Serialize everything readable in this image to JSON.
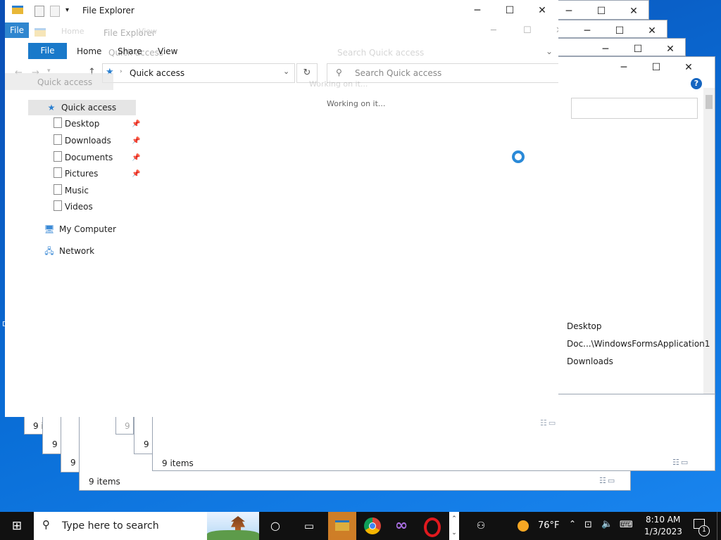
{
  "app": {
    "title": "File Explorer"
  },
  "ribbon": {
    "file": "File",
    "home": "Home",
    "share": "Share",
    "view": "View"
  },
  "address": {
    "location": "Quick access"
  },
  "search": {
    "placeholder": "Search Quick access"
  },
  "status": {
    "working": "Working on it...",
    "items": "9 items"
  },
  "sidebar": {
    "quick_access": "Quick access",
    "items": [
      {
        "label": "Desktop",
        "pinned": true
      },
      {
        "label": "Downloads",
        "pinned": true
      },
      {
        "label": "Documents",
        "pinned": true
      },
      {
        "label": "Pictures",
        "pinned": true
      },
      {
        "label": "Music",
        "pinned": false
      },
      {
        "label": "Videos",
        "pinned": false
      }
    ],
    "my_computer": "My Computer",
    "network": "Network"
  },
  "recent_paths": [
    "Desktop",
    "Doc...\\WindowsFormsApplication1",
    "Downloads"
  ],
  "partial_counts": [
    "9 i",
    "9 i",
    "9 i",
    "9 i"
  ],
  "taskbar": {
    "search_placeholder": "Type here to search",
    "temperature": "76°F",
    "time": "8:10 AM",
    "date": "1/3/2023",
    "notifications": "1"
  },
  "colors": {
    "accent": "#1979ca",
    "taskbar": "#111111",
    "selection": "#e5e5e5"
  }
}
